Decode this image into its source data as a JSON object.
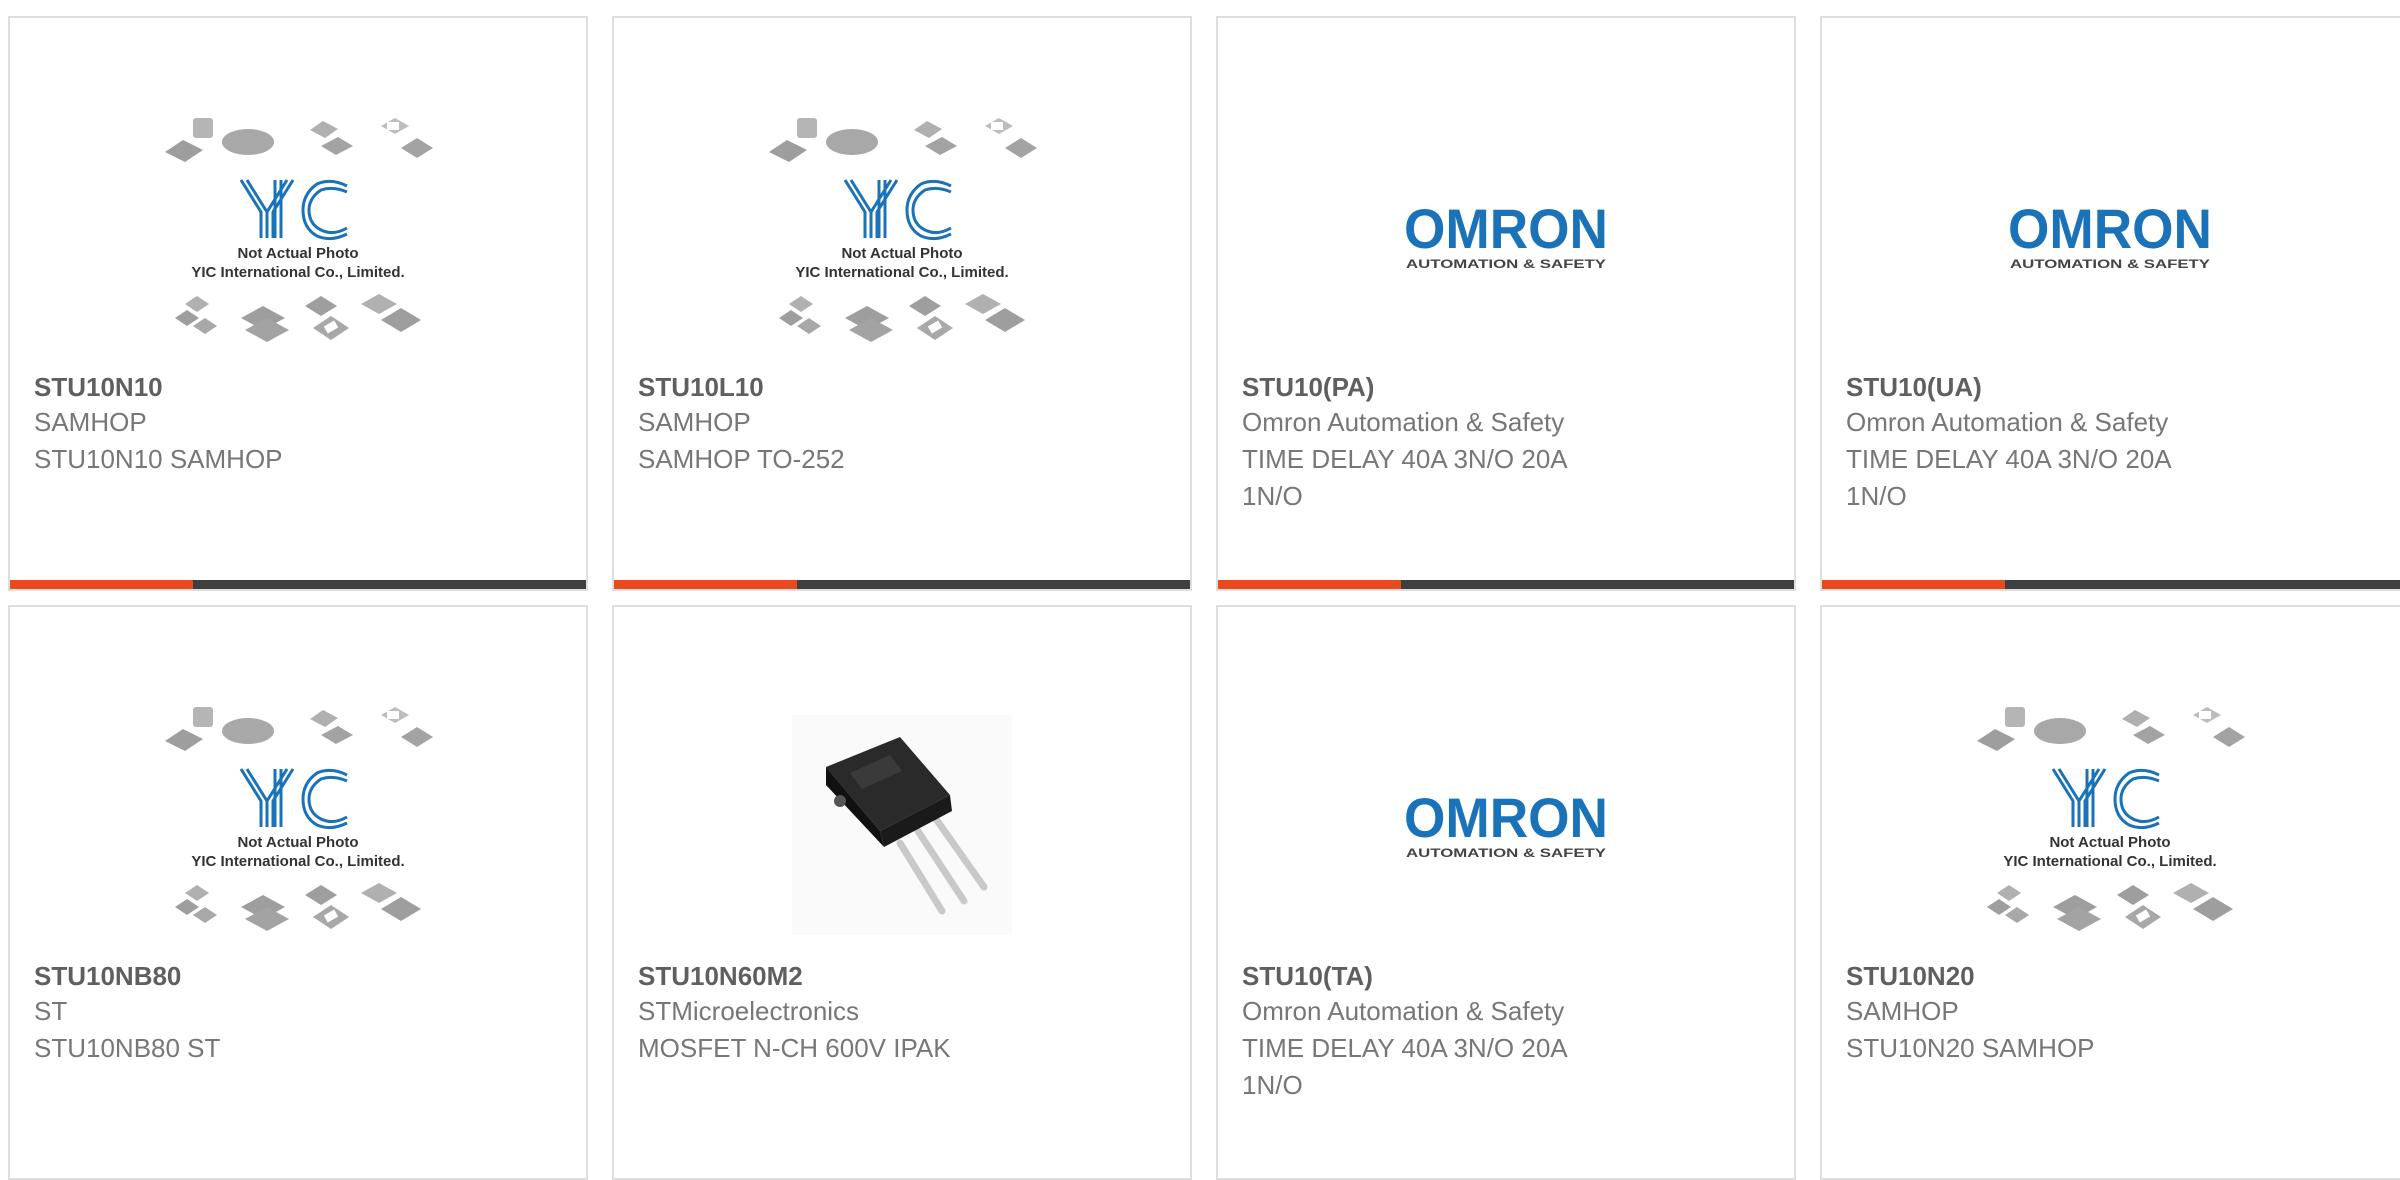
{
  "products": [
    {
      "part": "STU10N10",
      "manufacturer": "SAMHOP",
      "description": "STU10N10 SAMHOP",
      "image": "yic-placeholder-image",
      "image_text_1": "Not Actual Photo",
      "image_text_2": "YIC International Co., Limited."
    },
    {
      "part": "STU10L10",
      "manufacturer": "SAMHOP",
      "description": "SAMHOP TO-252",
      "image": "yic-placeholder-image",
      "image_text_1": "Not Actual Photo",
      "image_text_2": "YIC International Co., Limited."
    },
    {
      "part": "STU10(PA)",
      "manufacturer": "Omron Automation & Safety",
      "description": "TIME DELAY 40A 3N/O 20A 1N/O",
      "image": "omron-logo",
      "logo_text": "OMRON",
      "logo_tagline": "AUTOMATION & SAFETY"
    },
    {
      "part": "STU10(UA)",
      "manufacturer": "Omron Automation & Safety",
      "description": "TIME DELAY 40A 3N/O 20A 1N/O",
      "image": "omron-logo",
      "logo_text": "OMRON",
      "logo_tagline": "AUTOMATION & SAFETY"
    },
    {
      "part": "STU10NB80",
      "manufacturer": "ST",
      "description": "STU10NB80 ST",
      "image": "yic-placeholder-image",
      "image_text_1": "Not Actual Photo",
      "image_text_2": "YIC International Co., Limited."
    },
    {
      "part": "STU10N60M2",
      "manufacturer": "STMicroelectronics",
      "description": "MOSFET N-CH 600V IPAK",
      "image": "ipak-transistor-photo"
    },
    {
      "part": "STU10(TA)",
      "manufacturer": "Omron Automation & Safety",
      "description": "TIME DELAY 40A 3N/O 20A 1N/O",
      "image": "omron-logo",
      "logo_text": "OMRON",
      "logo_tagline": "AUTOMATION & SAFETY"
    },
    {
      "part": "STU10N20",
      "manufacturer": "SAMHOP",
      "description": "STU10N20 SAMHOP",
      "image": "yic-placeholder-image",
      "image_text_1": "Not Actual Photo",
      "image_text_2": "YIC International Co., Limited."
    }
  ],
  "colors": {
    "accent": "#e84a1c",
    "bar": "#3f3f3f",
    "title": "#5f5f5f",
    "text": "#777777",
    "omron_blue": "#1a72b8",
    "yic_blue": "#1a73b8"
  }
}
